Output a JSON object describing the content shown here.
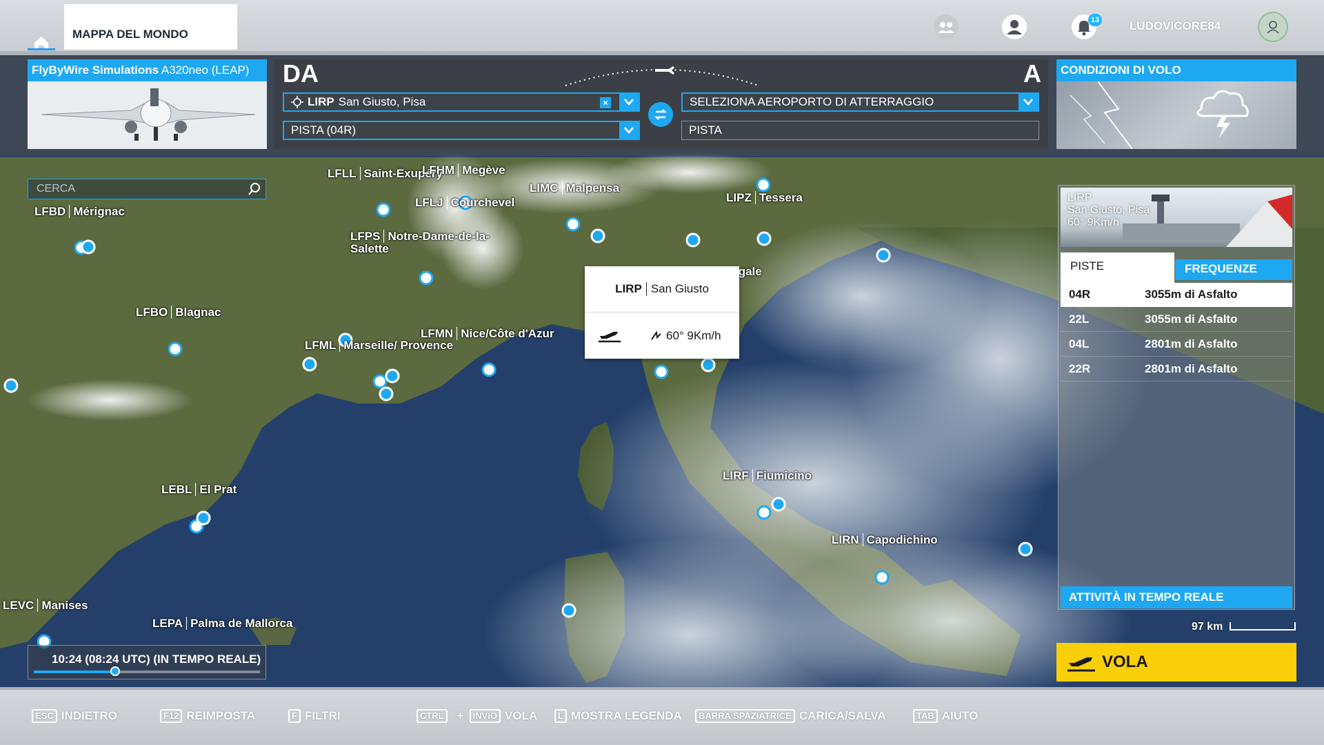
{
  "topbar": {
    "world_map_tab": "MAPPA DEL MONDO",
    "notifications_count": "13",
    "username": "LUDOVICORE84"
  },
  "aircraft": {
    "brand": "FlyByWire Simulations",
    "model": "A320neo (LEAP)"
  },
  "route": {
    "from_label": "DA",
    "to_label": "A",
    "departure": {
      "code": "LIRP",
      "name": "San Giusto, Pisa",
      "clear": "×"
    },
    "departure_runway": "PISTA (04R)",
    "arrival_placeholder": "SELEZIONA AEROPORTO DI ATTERRAGGIO",
    "arrival_runway": "PISTA"
  },
  "conditions": {
    "title": "CONDIZIONI DI VOLO"
  },
  "search": {
    "placeholder": "CERCA"
  },
  "map_labels": [
    {
      "code": "LFLL",
      "name": "Saint-Exupéry"
    },
    {
      "code": "LFHM",
      "name": "Megève"
    },
    {
      "code": "LFLJ",
      "name": "Courchevel"
    },
    {
      "code": "LIMC",
      "name": "Malpensa"
    },
    {
      "code": "LIPZ",
      "name": "Tessera"
    },
    {
      "code": "LFBD",
      "name": "Mérignac"
    },
    {
      "code": "LFPS",
      "name": "Notre-Dame-de-la-Salette"
    },
    {
      "code": "LFBO",
      "name": "Blagnac"
    },
    {
      "code": "LFMN",
      "name": "Nice/Côte d'Azur"
    },
    {
      "code": "LFML",
      "name": "Marseille/ Provence"
    },
    {
      "code": "LIRF",
      "name": "Fiumicino"
    },
    {
      "code": "LEBL",
      "name": "El Prat"
    },
    {
      "code": "LIRN",
      "name": "Capodichino"
    },
    {
      "code": "LEVC",
      "name": "Manises"
    },
    {
      "code": "LEPA",
      "name": "Palma de Mallorca"
    },
    {
      "code": "",
      "name": "igale"
    }
  ],
  "popup": {
    "code": "LIRP",
    "name": "San Giusto",
    "wind": "60° 9Km/h"
  },
  "airport_panel": {
    "code": "LIRP",
    "name": "San Giusto, Pisa",
    "wind": "60° 9Km/h",
    "tab_runways": "PISTE",
    "tab_frequencies": "FREQUENZE",
    "runways": [
      {
        "id": "04R",
        "info": "3055m di Asfalto"
      },
      {
        "id": "22L",
        "info": "3055m di Asfalto"
      },
      {
        "id": "04L",
        "info": "2801m di Asfalto"
      },
      {
        "id": "22R",
        "info": "2801m di Asfalto"
      }
    ],
    "live_activity": "ATTIVITÀ IN TEMPO REALE"
  },
  "scale": {
    "label": "97 km"
  },
  "fly_button": "VOLA",
  "time": {
    "text": "10:24 (08:24 UTC) (IN TEMPO REALE)",
    "progress": 0.36
  },
  "hints": [
    {
      "keys": [
        "ESC"
      ],
      "label": "INDIETRO"
    },
    {
      "keys": [
        "F12"
      ],
      "label": "REIMPOSTA"
    },
    {
      "keys": [
        "F"
      ],
      "label": "FILTRI"
    },
    {
      "keys": [
        "CTRL",
        "INVIO"
      ],
      "plus": "+",
      "label": "VOLA"
    },
    {
      "keys": [
        "L"
      ],
      "label": "MOSTRA LEGENDA"
    },
    {
      "keys": [
        "BARRA SPAZIATRICE"
      ],
      "label": "CARICA/SALVA"
    },
    {
      "keys": [
        "TAB"
      ],
      "label": "AIUTO"
    }
  ],
  "colors": {
    "accent": "#1ea8f2",
    "fly": "#f9cf09"
  }
}
